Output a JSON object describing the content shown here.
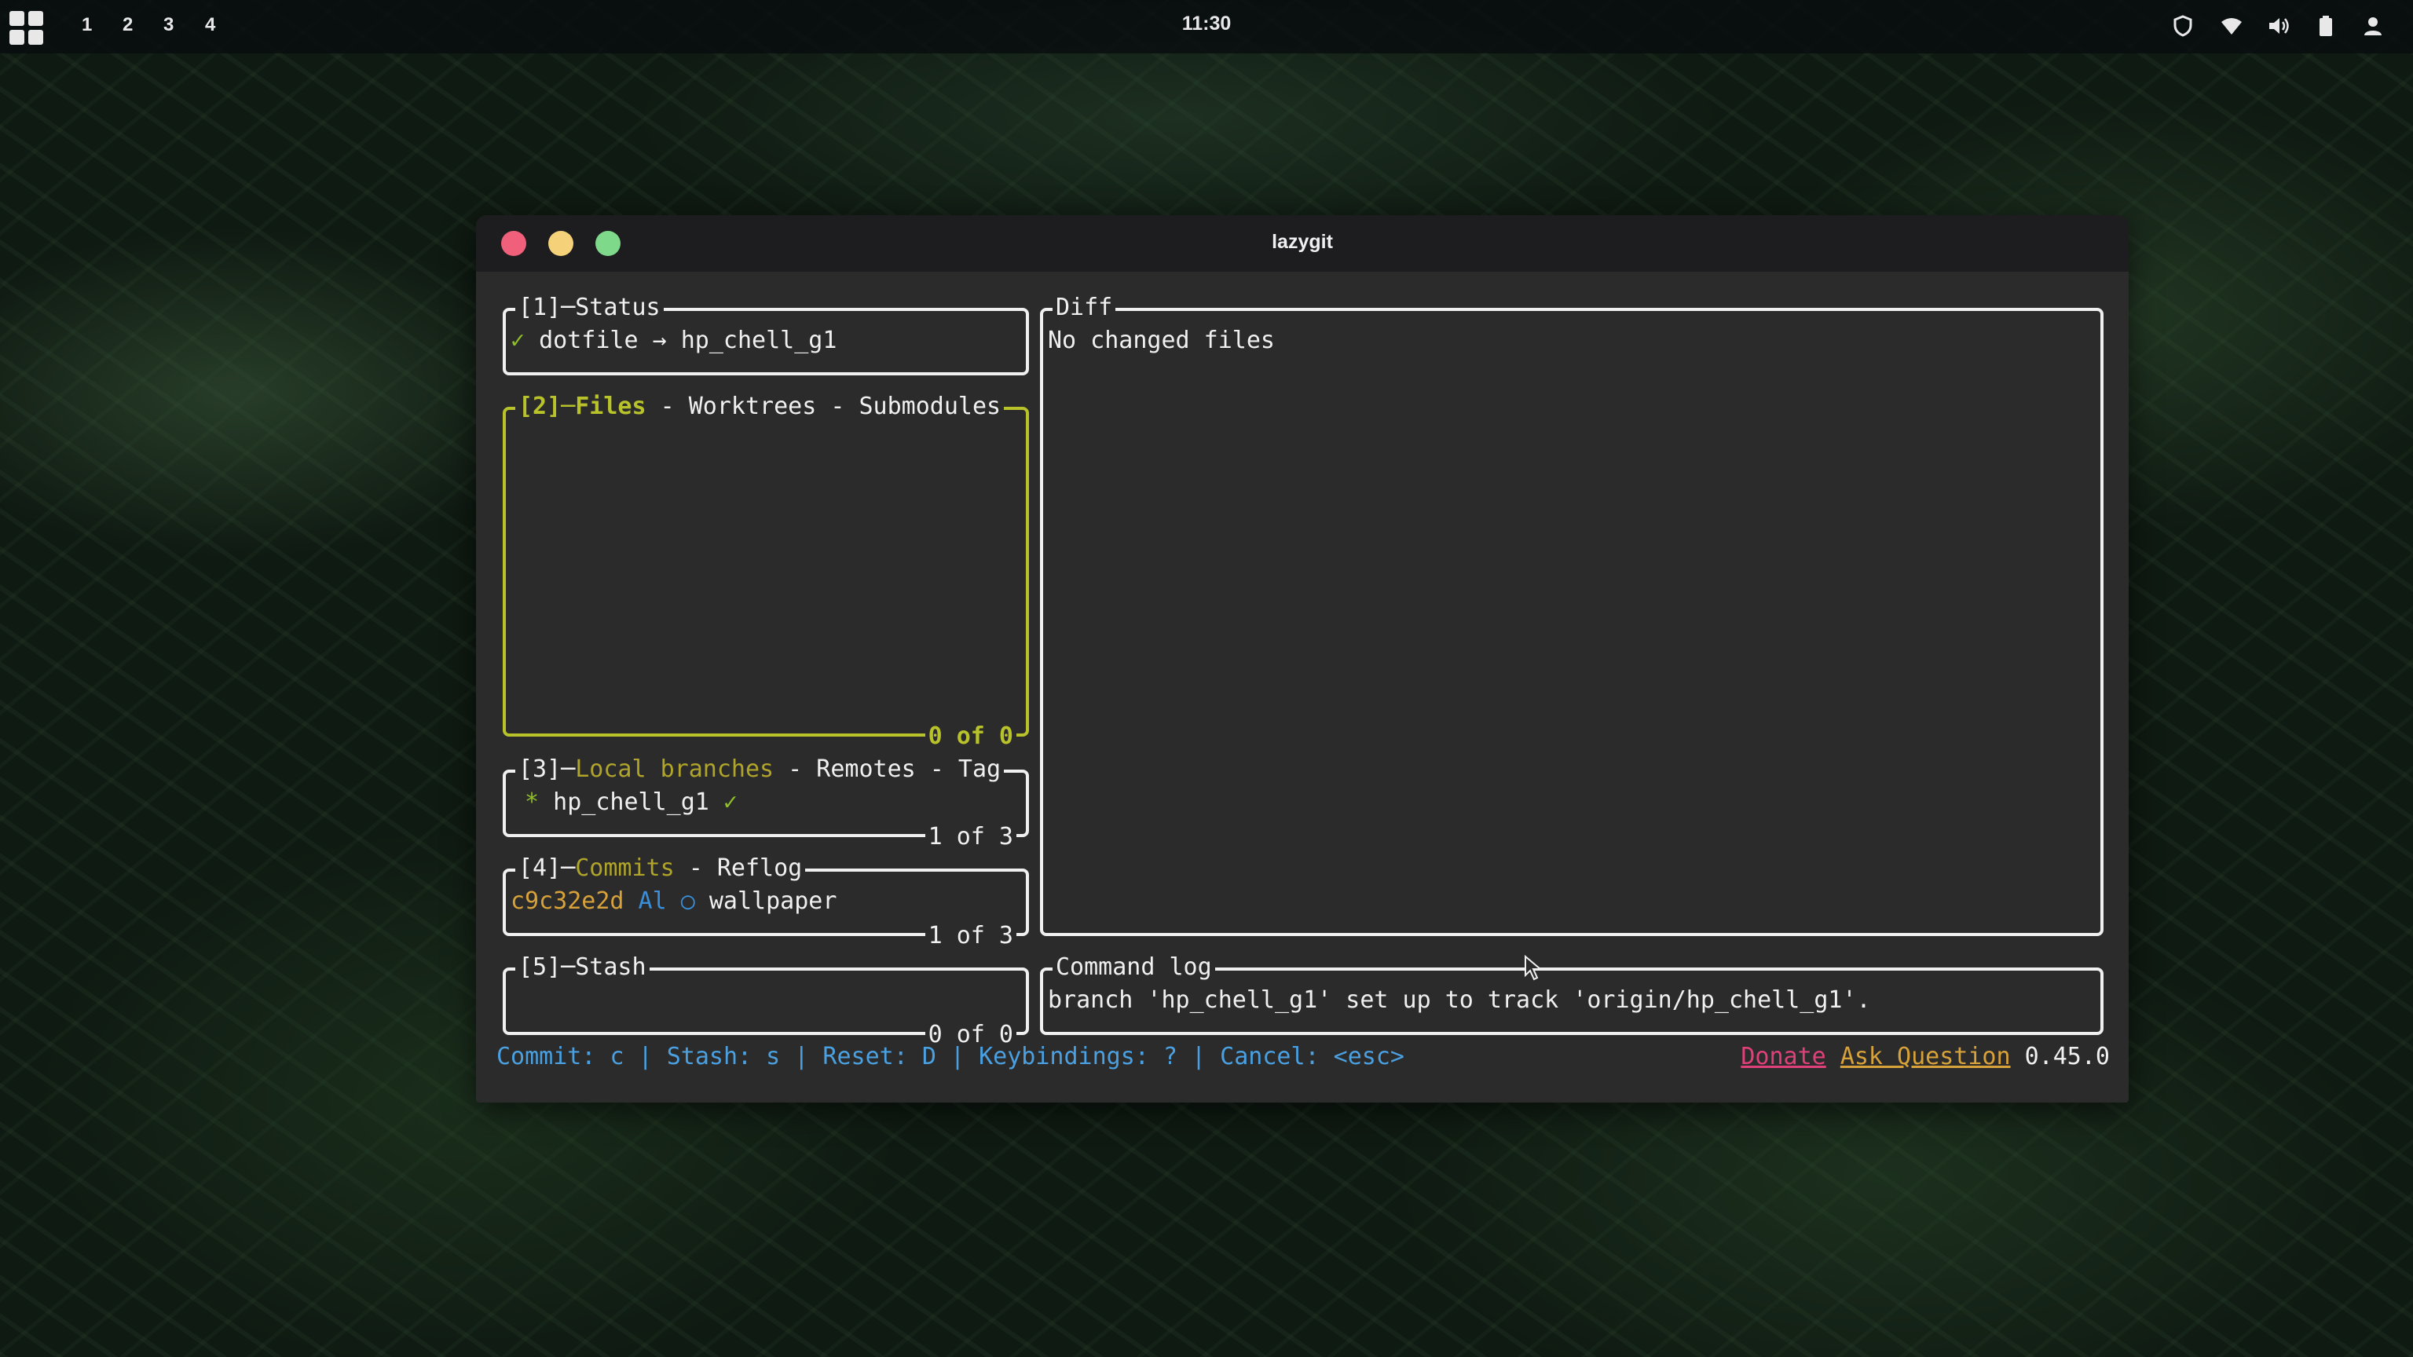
{
  "topbar": {
    "workspaces": [
      "1",
      "2",
      "3",
      "4"
    ],
    "clock": "11:30",
    "tray_icons": [
      "shield-icon",
      "wifi-icon",
      "volume-icon",
      "battery-icon",
      "user-icon"
    ]
  },
  "window": {
    "title": "lazygit",
    "controls": [
      "close",
      "minimize",
      "maximize"
    ],
    "colors": {
      "close": "#f0607a",
      "minimize": "#f5d27a",
      "maximize": "#7fd98a"
    }
  },
  "panels": {
    "status": {
      "title": "[1]─Status",
      "check": "✓",
      "text": " dotfile → hp_chell_g1"
    },
    "files": {
      "title_num": "[2]─",
      "title_active": "Files",
      "title_rest": " - Worktrees - Submodules",
      "footer": "0 of 0"
    },
    "branches": {
      "title_num": "[3]─",
      "title_active": "Local branches",
      "title_rest": " - Remotes - Tag",
      "row_marker": " *",
      "row_name": " hp_chell_g1",
      "row_check": " ✓",
      "footer": "1 of 3"
    },
    "commits": {
      "title_num": "[4]─",
      "title_active": "Commits",
      "title_rest": " - Reflog",
      "hash": "c9c32e2d",
      "author": " Al",
      "marker": " ○",
      "message": " wallpaper",
      "footer": "1 of 3"
    },
    "stash": {
      "title": "[5]─Stash",
      "footer": "0 of 0"
    },
    "diff": {
      "title": "Diff",
      "text": "No changed files"
    },
    "command_log": {
      "title": "Command log",
      "text": "branch 'hp_chell_g1' set up to track 'origin/hp_chell_g1'."
    }
  },
  "statusbar": {
    "keybinds": "Commit: c | Stash: s | Reset: D | Keybindings: ? | Cancel: <esc>",
    "donate": "Donate",
    "ask": "Ask Question",
    "version": " 0.45.0"
  }
}
